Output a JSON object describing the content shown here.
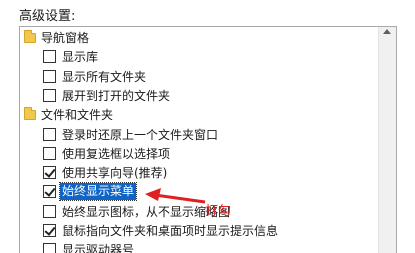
{
  "section_label": "高级设置:",
  "items": [
    {
      "type": "folder",
      "label": "导航窗格"
    },
    {
      "type": "check",
      "label": "显示库",
      "checked": false
    },
    {
      "type": "check",
      "label": "显示所有文件夹",
      "checked": false
    },
    {
      "type": "check",
      "label": "展开到打开的文件夹",
      "checked": false
    },
    {
      "type": "folder",
      "label": "文件和文件夹"
    },
    {
      "type": "check",
      "label": "登录时还原上一个文件夹窗口",
      "checked": false
    },
    {
      "type": "check",
      "label": "使用复选框以选择项",
      "checked": false
    },
    {
      "type": "check",
      "label": "使用共享向导(推荐)",
      "checked": true
    },
    {
      "type": "check",
      "label": "始终显示菜单",
      "checked": true,
      "selected": true
    },
    {
      "type": "check",
      "label": "始终显示图标，从不显示缩略图",
      "checked": false
    },
    {
      "type": "check",
      "label": "鼠标指向文件夹和桌面项时显示提示信息",
      "checked": true
    },
    {
      "type": "check",
      "label": "显示驱动器号",
      "checked": false
    }
  ],
  "annotation": {
    "text": "打勾",
    "color": "#e02020"
  }
}
